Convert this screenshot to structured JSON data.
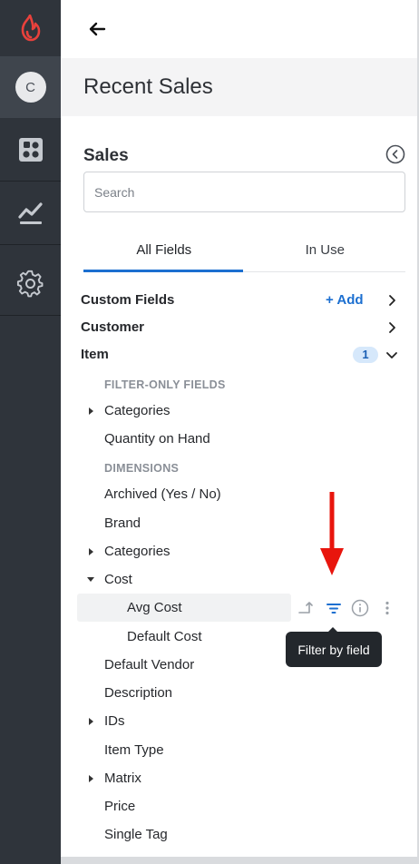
{
  "rail": {
    "avatar_initial": "C",
    "items": [
      {
        "icon": "dashboard-icon"
      },
      {
        "icon": "reports-chart-icon"
      },
      {
        "icon": "gear-icon"
      }
    ],
    "colors": {
      "logo": "#e8413c",
      "background": "#2f343b",
      "selected": "#3f454d"
    }
  },
  "header": {
    "page_title": "Recent Sales"
  },
  "panel": {
    "title": "Sales",
    "search_placeholder": "Search",
    "tabs": [
      {
        "label": "All Fields",
        "active": true
      },
      {
        "label": "In Use",
        "active": false
      }
    ]
  },
  "tree": {
    "custom_fields": {
      "label": "Custom Fields",
      "add_label": "+ Add"
    },
    "customer": {
      "label": "Customer"
    },
    "item": {
      "label": "Item",
      "badge": "1",
      "filter_only_header": "FILTER-ONLY FIELDS",
      "filter_only": [
        {
          "label": "Categories",
          "expandable": true
        },
        {
          "label": "Quantity on Hand",
          "expandable": false
        }
      ],
      "dimensions_header": "DIMENSIONS",
      "dimensions": {
        "archived": "Archived (Yes / No)",
        "brand": "Brand",
        "categories": "Categories",
        "cost": "Cost",
        "avg_cost": "Avg Cost",
        "default_cost": "Default Cost",
        "default_vendor": "Default Vendor",
        "description": "Description",
        "ids": "IDs",
        "item_type": "Item Type",
        "matrix": "Matrix",
        "price": "Price",
        "single_tag": "Single Tag"
      }
    }
  },
  "tooltip": {
    "text": "Filter by field"
  },
  "colors": {
    "accent": "#1c6fd0",
    "annotation_arrow": "#e8150d",
    "tooltip_bg": "#23272c"
  }
}
